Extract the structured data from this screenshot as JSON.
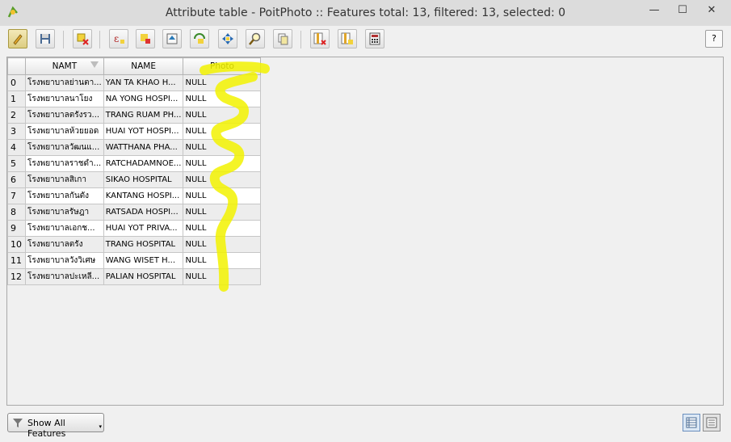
{
  "window": {
    "title": "Attribute table - PoitPhoto :: Features total: 13, filtered: 13, selected: 0",
    "minimize": "—",
    "maximize": "☐",
    "close": "✕"
  },
  "toolbar": {
    "buttons": [
      {
        "name": "toggle-editing",
        "icon": "pencil-icon"
      },
      {
        "name": "save-edits",
        "icon": "save-icon"
      },
      {
        "name": "delete-selected",
        "icon": "delete-feature-icon"
      },
      {
        "name": "expression-select",
        "icon": "expression-icon"
      },
      {
        "name": "unselect-all",
        "icon": "deselect-icon"
      },
      {
        "name": "move-selection-top",
        "icon": "move-top-icon"
      },
      {
        "name": "invert-selection",
        "icon": "invert-icon"
      },
      {
        "name": "pan-to-selected",
        "icon": "pan-icon"
      },
      {
        "name": "zoom-to-selected",
        "icon": "zoom-icon"
      },
      {
        "name": "copy-selected",
        "icon": "copy-icon"
      },
      {
        "name": "new-column",
        "icon": "new-column-icon"
      },
      {
        "name": "delete-column",
        "icon": "delete-column-icon"
      },
      {
        "name": "field-calculator",
        "icon": "calculator-icon"
      }
    ],
    "help_label": "?"
  },
  "table": {
    "columns": [
      "NAMT",
      "NAME",
      "Photo"
    ],
    "rows": [
      {
        "idx": "0",
        "namt": "โรงพยาบาลย่านตา...",
        "name": "YAN TA KHAO H...",
        "photo": "NULL"
      },
      {
        "idx": "1",
        "namt": "โรงพยาบาลนาโยง",
        "name": "NA YONG HOSPI...",
        "photo": "NULL"
      },
      {
        "idx": "2",
        "namt": "โรงพยาบาลตรังรว...",
        "name": "TRANG RUAM PH...",
        "photo": "NULL"
      },
      {
        "idx": "3",
        "namt": "โรงพยาบาลห้วยยอด",
        "name": "HUAI YOT HOSPI...",
        "photo": "NULL"
      },
      {
        "idx": "4",
        "namt": "โรงพยาบาลวัฒนแ...",
        "name": "WATTHANA PHA...",
        "photo": "NULL"
      },
      {
        "idx": "5",
        "namt": "โรงพยาบาลราชดำ...",
        "name": "RATCHADAMNOE...",
        "photo": "NULL"
      },
      {
        "idx": "6",
        "namt": "โรงพยาบาลสิเกา",
        "name": "SIKAO HOSPITAL",
        "photo": "NULL"
      },
      {
        "idx": "7",
        "namt": "โรงพยาบาลกันตัง",
        "name": "KANTANG HOSPI...",
        "photo": "NULL"
      },
      {
        "idx": "8",
        "namt": "โรงพยาบาลรัษฎา",
        "name": "RATSADA HOSPI...",
        "photo": "NULL"
      },
      {
        "idx": "9",
        "namt": "โรงพยาบาลเอกช...",
        "name": "HUAI YOT PRIVA...",
        "photo": "NULL"
      },
      {
        "idx": "10",
        "namt": "โรงพยาบาลตรัง",
        "name": "TRANG HOSPITAL",
        "photo": "NULL"
      },
      {
        "idx": "11",
        "namt": "โรงพยาบาลวังวิเศษ",
        "name": "WANG WISET H...",
        "photo": "NULL"
      },
      {
        "idx": "12",
        "namt": "โรงพยาบาลปะเหลี...",
        "name": "PALIAN HOSPITAL",
        "photo": "NULL"
      }
    ]
  },
  "bottom": {
    "show_features_label": "Show All Features",
    "show_features_caret": "▾"
  },
  "colors": {
    "highlight": "#f2f200",
    "active_tool": "#dccd82"
  }
}
